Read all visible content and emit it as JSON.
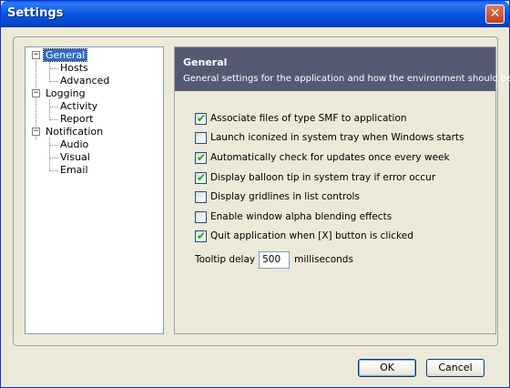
{
  "window": {
    "title": "Settings",
    "close_glyph": "✕",
    "icons": {
      "close": "close-icon"
    }
  },
  "tree": {
    "items": [
      {
        "label": "General",
        "level": 0,
        "expanded": true,
        "selected": true
      },
      {
        "label": "Hosts",
        "level": 1
      },
      {
        "label": "Advanced",
        "level": 1
      },
      {
        "label": "Logging",
        "level": 0,
        "expanded": true
      },
      {
        "label": "Activity",
        "level": 1
      },
      {
        "label": "Report",
        "level": 1
      },
      {
        "label": "Notification",
        "level": 0,
        "expanded": true
      },
      {
        "label": "Audio",
        "level": 1
      },
      {
        "label": "Visual",
        "level": 1
      },
      {
        "label": "Email",
        "level": 1
      }
    ],
    "expander_glyph": "−"
  },
  "panel": {
    "title": "General",
    "subtitle": "General settings for the application and how the environment should behave",
    "options": [
      {
        "label": "Associate files of type SMF to application",
        "checked": true
      },
      {
        "label": "Launch iconized in system tray when Windows starts",
        "checked": false
      },
      {
        "label": "Automatically check for updates once every week",
        "checked": true
      },
      {
        "label": "Display balloon tip in system tray if error occur",
        "checked": true
      },
      {
        "label": "Display gridlines in list controls",
        "checked": false
      },
      {
        "label": "Enable window alpha blending effects",
        "checked": false
      },
      {
        "label": "Quit application when [X] button is clicked",
        "checked": true
      }
    ],
    "tooltip": {
      "label": "Tooltip delay",
      "value": "500",
      "unit": "milliseconds"
    }
  },
  "buttons": {
    "ok": "OK",
    "cancel": "Cancel"
  },
  "colors": {
    "titlebar": "#0a55df",
    "header": "#555a73",
    "selection": "#316ac5",
    "checkmark": "#21a121"
  }
}
